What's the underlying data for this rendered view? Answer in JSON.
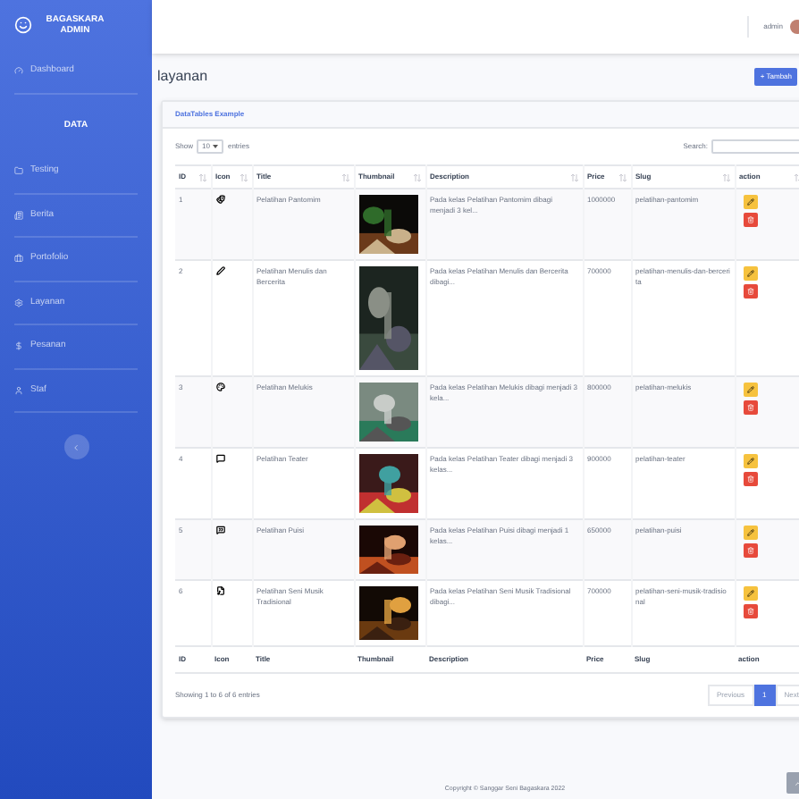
{
  "sidebar": {
    "brand": "BAGASKARA ADMIN",
    "items": [
      {
        "kind": "link",
        "label": "Dashboard",
        "selected": false
      },
      {
        "kind": "heading",
        "label": "DATA"
      },
      {
        "kind": "link",
        "label": "Testing",
        "selected": false
      },
      {
        "kind": "link",
        "label": "Berita",
        "selected": false
      },
      {
        "kind": "link",
        "label": "Portofolio",
        "selected": false
      },
      {
        "kind": "link",
        "label": "Layanan",
        "selected": false
      },
      {
        "kind": "link",
        "label": "Pesanan",
        "selected": false
      },
      {
        "kind": "link",
        "label": "Staf",
        "selected": false
      }
    ]
  },
  "topbar": {
    "user": "admin"
  },
  "page": {
    "title": "layanan",
    "add_button": "+ Tambah"
  },
  "card": {
    "title": "DataTables Example",
    "show_label": "Show",
    "page_size": "10",
    "entries_label": "entries",
    "search_label": "Search:",
    "columns": [
      "ID",
      "Icon",
      "Title",
      "Thumbnail",
      "Description",
      "Price",
      "Slug",
      "action"
    ],
    "footer_columns": [
      "ID",
      "Icon",
      "Title",
      "Thumbnail",
      "Description",
      "Price",
      "Slug",
      "action"
    ],
    "rows": [
      {
        "id": "1",
        "title": "Pelatihan Pantomim",
        "description": "Pada kelas Pelatihan Pantomim dibagi menjadi 3 kel...",
        "price": "1000000",
        "slug": "pelatihan-pantomim"
      },
      {
        "id": "2",
        "title": "Pelatihan Menulis dan Bercerita",
        "description": "Pada kelas Pelatihan Menulis dan Bercerita dibagi...",
        "price": "700000",
        "slug": "pelatihan-menulis-dan-bercerita"
      },
      {
        "id": "3",
        "title": "Pelatihan Melukis",
        "description": "Pada kelas Pelatihan Melukis dibagi menjadi 3 kela...",
        "price": "800000",
        "slug": "pelatihan-melukis"
      },
      {
        "id": "4",
        "title": "Pelatihan Teater",
        "description": "Pada kelas Pelatihan Teater dibagi menjadi 3 kelas...",
        "price": "900000",
        "slug": "pelatihan-teater"
      },
      {
        "id": "5",
        "title": "Pelatihan Puisi",
        "description": "Pada kelas Pelatihan Puisi dibagi menjadi 1 kelas...",
        "price": "650000",
        "slug": "pelatihan-puisi"
      },
      {
        "id": "6",
        "title": "Pelatihan Seni Musik Tradisional",
        "description": "Pada kelas Pelatihan Seni Musik Tradisional dibagi...",
        "price": "700000",
        "slug": "pelatihan-seni-musik-tradisional"
      }
    ],
    "info": "Showing 1 to 6 of 6 entries",
    "pagination": [
      {
        "label": "Previous",
        "selected": false
      },
      {
        "label": "1",
        "selected": true
      },
      {
        "label": "Next",
        "selected": false
      }
    ]
  },
  "footer": "Copyright © Sanggar Seni Bagaskara 2022"
}
